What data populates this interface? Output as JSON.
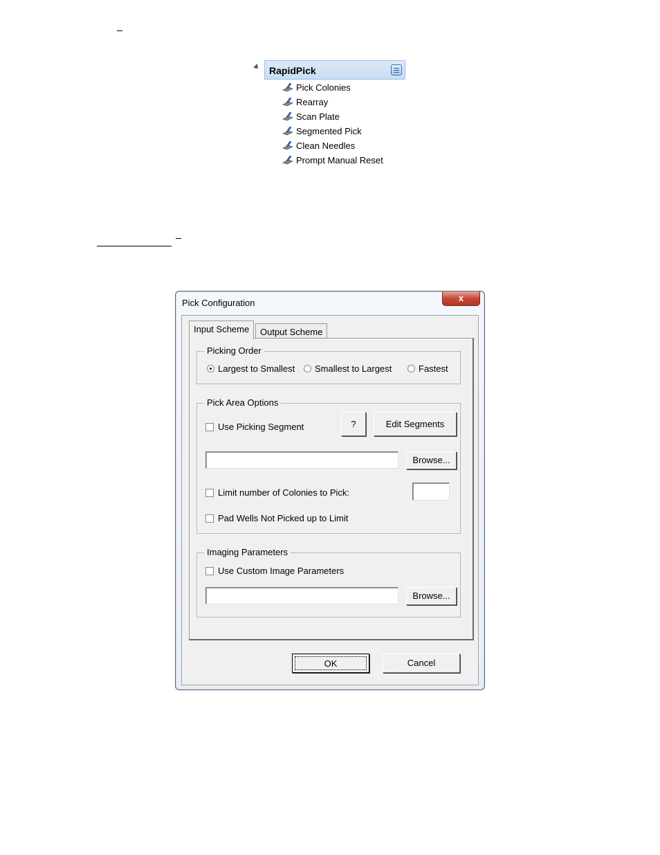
{
  "tree": {
    "root_label": "RapidPick",
    "items": [
      {
        "label": "Pick Colonies"
      },
      {
        "label": "Rearray"
      },
      {
        "label": "Scan Plate"
      },
      {
        "label": "Segmented Pick"
      },
      {
        "label": "Clean Needles"
      },
      {
        "label": "Prompt Manual Reset"
      }
    ]
  },
  "dialog": {
    "title": "Pick Configuration",
    "close_label": "x",
    "tabs": [
      {
        "label": "Input Scheme",
        "active": true
      },
      {
        "label": "Output Scheme",
        "active": false
      }
    ],
    "picking_order": {
      "label": "Picking Order",
      "options": [
        {
          "label": "Largest to Smallest",
          "selected": true
        },
        {
          "label": "Smallest to Largest",
          "selected": false
        },
        {
          "label": "Fastest",
          "selected": false
        }
      ]
    },
    "pick_area": {
      "label": "Pick Area Options",
      "use_segment_label": "Use Picking Segment",
      "help_label": "?",
      "edit_segments_label": "Edit Segments",
      "path_value": "",
      "browse_label": "Browse...",
      "limit_label": "Limit number of Colonies to Pick:",
      "limit_value": "",
      "pad_label": "Pad Wells Not Picked up to Limit"
    },
    "imaging": {
      "label": "Imaging Parameters",
      "custom_label": "Use Custom Image Parameters",
      "path_value": "",
      "browse_label": "Browse..."
    },
    "ok_label": "OK",
    "cancel_label": "Cancel"
  }
}
